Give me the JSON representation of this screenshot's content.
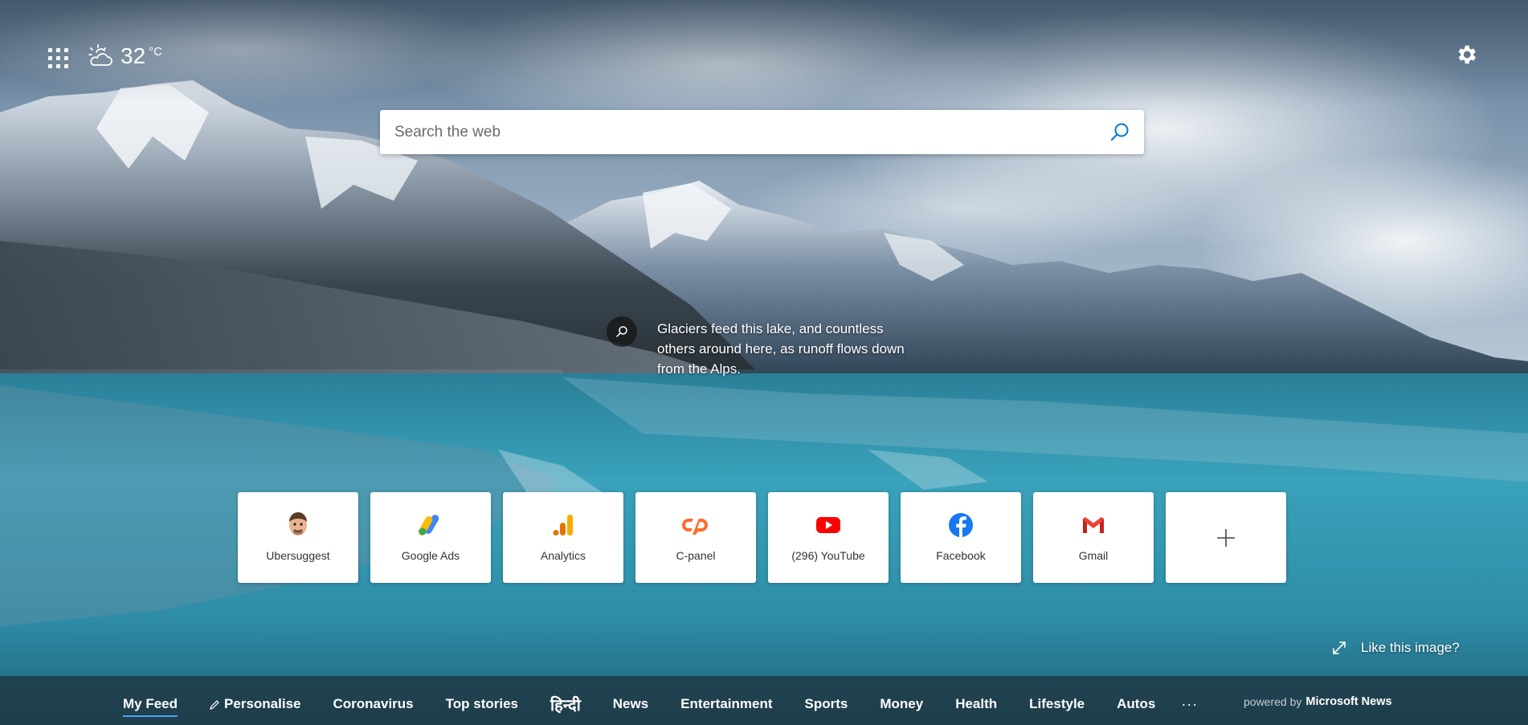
{
  "weather": {
    "temperature": "32",
    "unit": "°C"
  },
  "search": {
    "placeholder": "Search the web"
  },
  "image_caption": "Glaciers feed this lake, and countless others around here, as runoff flows down from the Alps.",
  "quick_links": [
    {
      "label": "Ubersuggest",
      "icon": "ubersuggest-icon"
    },
    {
      "label": "Google Ads",
      "icon": "google-ads-icon"
    },
    {
      "label": "Analytics",
      "icon": "analytics-icon"
    },
    {
      "label": "C-panel",
      "icon": "cpanel-icon"
    },
    {
      "label": "(296) YouTube",
      "icon": "youtube-icon"
    },
    {
      "label": "Facebook",
      "icon": "facebook-icon"
    },
    {
      "label": "Gmail",
      "icon": "gmail-icon"
    }
  ],
  "like_image": "Like this image?",
  "nav": {
    "items": [
      "My Feed",
      "Personalise",
      "Coronavirus",
      "Top stories",
      "हिन्दी",
      "News",
      "Entertainment",
      "Sports",
      "Money",
      "Health",
      "Lifestyle",
      "Autos"
    ],
    "more": "···"
  },
  "powered_by": {
    "prefix": "powered by",
    "brand": "Microsoft News"
  },
  "colors": {
    "accent": "#0078d4",
    "nav_underline": "#4aa3ff"
  }
}
